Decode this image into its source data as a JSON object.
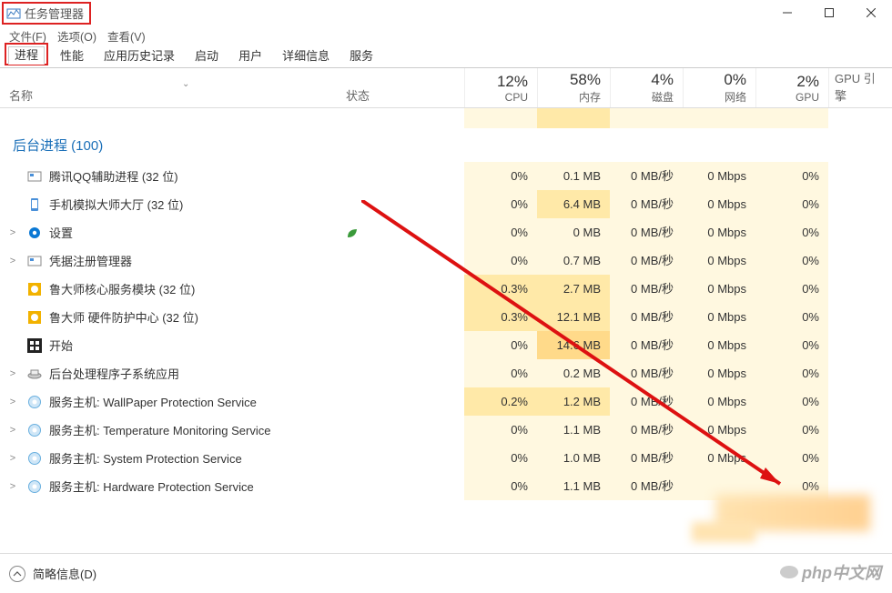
{
  "title": "任务管理器",
  "menu": [
    "文件(F)",
    "选项(O)",
    "查看(V)"
  ],
  "tabs": {
    "active": "进程",
    "items": [
      "进程",
      "性能",
      "应用历史记录",
      "启动",
      "用户",
      "详细信息",
      "服务"
    ]
  },
  "columns": {
    "name": "名称",
    "status": "状态",
    "cpu": {
      "pct": "12%",
      "label": "CPU"
    },
    "mem": {
      "pct": "58%",
      "label": "内存"
    },
    "disk": {
      "pct": "4%",
      "label": "磁盘"
    },
    "net": {
      "pct": "0%",
      "label": "网络"
    },
    "gpu": {
      "pct": "2%",
      "label": "GPU"
    },
    "gpu2": "GPU 引擎"
  },
  "group": "后台进程 (100)",
  "processes": [
    {
      "expand": "",
      "icon": "qq",
      "name": "腾讯QQ辅助进程 (32 位)",
      "leaf": false,
      "cpu": "0%",
      "cpuv": 0,
      "mem": "0.1 MB",
      "memv": 0,
      "disk": "0 MB/秒",
      "net": "0 Mbps",
      "gpu": "0%"
    },
    {
      "expand": "",
      "icon": "phone",
      "name": "手机模拟大师大厅 (32 位)",
      "leaf": false,
      "cpu": "0%",
      "cpuv": 0,
      "mem": "6.4 MB",
      "memv": 1,
      "disk": "0 MB/秒",
      "net": "0 Mbps",
      "gpu": "0%"
    },
    {
      "expand": ">",
      "icon": "gear",
      "name": "设置",
      "leaf": true,
      "cpu": "0%",
      "cpuv": 0,
      "mem": "0 MB",
      "memv": 0,
      "disk": "0 MB/秒",
      "net": "0 Mbps",
      "gpu": "0%"
    },
    {
      "expand": ">",
      "icon": "reg",
      "name": "凭据注册管理器",
      "leaf": false,
      "cpu": "0%",
      "cpuv": 0,
      "mem": "0.7 MB",
      "memv": 0,
      "disk": "0 MB/秒",
      "net": "0 Mbps",
      "gpu": "0%"
    },
    {
      "expand": "",
      "icon": "ludashi",
      "name": "鲁大师核心服务模块 (32 位)",
      "leaf": false,
      "cpu": "0.3%",
      "cpuv": 1,
      "mem": "2.7 MB",
      "memv": 1,
      "disk": "0 MB/秒",
      "net": "0 Mbps",
      "gpu": "0%"
    },
    {
      "expand": "",
      "icon": "ludashi",
      "name": "鲁大师 硬件防护中心 (32 位)",
      "leaf": false,
      "cpu": "0.3%",
      "cpuv": 1,
      "mem": "12.1 MB",
      "memv": 1,
      "disk": "0 MB/秒",
      "net": "0 Mbps",
      "gpu": "0%"
    },
    {
      "expand": "",
      "icon": "start",
      "name": "开始",
      "leaf": false,
      "cpu": "0%",
      "cpuv": 0,
      "mem": "14.6 MB",
      "memv": 2,
      "disk": "0 MB/秒",
      "net": "0 Mbps",
      "gpu": "0%"
    },
    {
      "expand": ">",
      "icon": "tray",
      "name": "后台处理程序子系统应用",
      "leaf": false,
      "cpu": "0%",
      "cpuv": 0,
      "mem": "0.2 MB",
      "memv": 0,
      "disk": "0 MB/秒",
      "net": "0 Mbps",
      "gpu": "0%"
    },
    {
      "expand": ">",
      "icon": "svc",
      "name": "服务主机: WallPaper Protection Service",
      "leaf": false,
      "cpu": "0.2%",
      "cpuv": 1,
      "mem": "1.2 MB",
      "memv": 1,
      "disk": "0 MB/秒",
      "net": "0 Mbps",
      "gpu": "0%"
    },
    {
      "expand": ">",
      "icon": "svc",
      "name": "服务主机: Temperature Monitoring Service",
      "leaf": false,
      "cpu": "0%",
      "cpuv": 0,
      "mem": "1.1 MB",
      "memv": 0,
      "disk": "0 MB/秒",
      "net": "0 Mbps",
      "gpu": "0%"
    },
    {
      "expand": ">",
      "icon": "svc",
      "name": "服务主机: System Protection Service",
      "leaf": false,
      "cpu": "0%",
      "cpuv": 0,
      "mem": "1.0 MB",
      "memv": 0,
      "disk": "0 MB/秒",
      "net": "0 Mbps",
      "gpu": "0%"
    },
    {
      "expand": ">",
      "icon": "svc",
      "name": "服务主机: Hardware Protection Service",
      "leaf": false,
      "cpu": "0%",
      "cpuv": 0,
      "mem": "1.1 MB",
      "memv": 0,
      "disk": "0 MB/秒",
      "net": "",
      "gpu": "0%"
    }
  ],
  "footer": "简略信息(D)",
  "watermark": "php中文网"
}
